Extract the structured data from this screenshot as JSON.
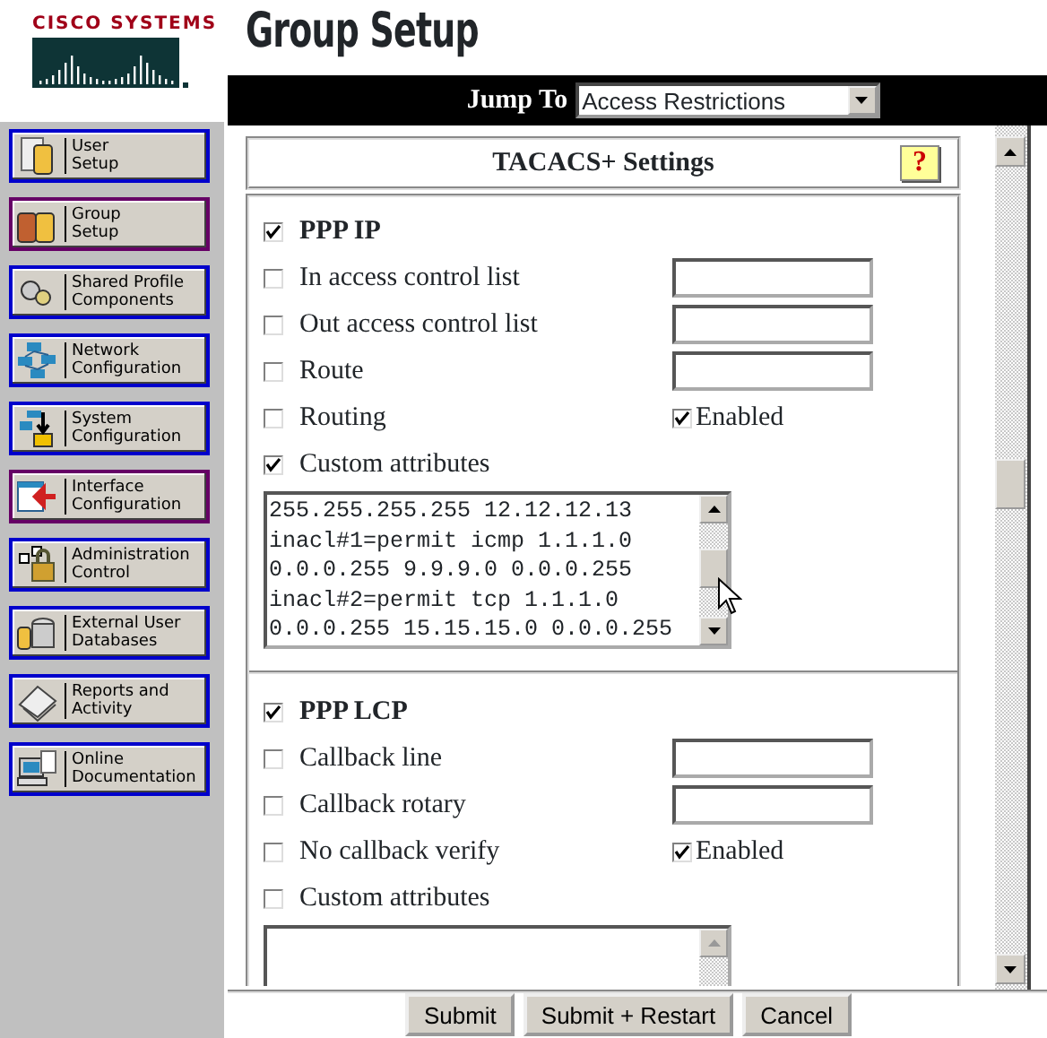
{
  "header": {
    "logo_text": "CISCO SYSTEMS",
    "title": "Group Setup"
  },
  "sidebar": {
    "items": [
      {
        "lines": [
          "User",
          "Setup"
        ],
        "color": "#0000cc"
      },
      {
        "lines": [
          "Group",
          "Setup"
        ],
        "color": "#660066"
      },
      {
        "lines": [
          "Shared Profile",
          "Components"
        ],
        "color": "#0000cc"
      },
      {
        "lines": [
          "Network",
          "Configuration"
        ],
        "color": "#0000cc"
      },
      {
        "lines": [
          "System",
          "Configuration"
        ],
        "color": "#0000cc"
      },
      {
        "lines": [
          "Interface",
          "Configuration"
        ],
        "color": "#660066"
      },
      {
        "lines": [
          "Administration",
          "Control"
        ],
        "color": "#0000cc"
      },
      {
        "lines": [
          "External User",
          "Databases"
        ],
        "color": "#0000cc"
      },
      {
        "lines": [
          "Reports and",
          "Activity"
        ],
        "color": "#0000cc"
      },
      {
        "lines": [
          "Online",
          "Documentation"
        ],
        "color": "#0000cc"
      }
    ]
  },
  "jump_to": {
    "label": "Jump To",
    "value": "Access Restrictions"
  },
  "panel": {
    "title": "TACACS+ Settings",
    "help": "?"
  },
  "sections": [
    {
      "title": "PPP IP",
      "checked": true,
      "rows": [
        {
          "kind": "text",
          "label": "In access control list",
          "checked": false
        },
        {
          "kind": "text",
          "label": "Out access control list",
          "checked": false
        },
        {
          "kind": "text",
          "label": "Route",
          "checked": false
        },
        {
          "kind": "option",
          "label": "Routing",
          "checked": false,
          "option_label": "Enabled",
          "option_checked": true
        },
        {
          "kind": "plain",
          "label": "Custom attributes",
          "checked": true
        }
      ],
      "attributes": [
        "255.255.255.255 12.12.12.13",
        "inacl#1=permit icmp 1.1.1.0",
        "0.0.0.255 9.9.9.0 0.0.0.255",
        "inacl#2=permit tcp 1.1.1.0",
        "0.0.0.255 15.15.15.0 0.0.0.255"
      ]
    },
    {
      "title": "PPP LCP",
      "checked": true,
      "rows": [
        {
          "kind": "text",
          "label": "Callback line",
          "checked": false
        },
        {
          "kind": "text",
          "label": "Callback rotary",
          "checked": false
        },
        {
          "kind": "option",
          "label": "No callback verify",
          "checked": false,
          "option_label": "Enabled",
          "option_checked": true
        },
        {
          "kind": "plain",
          "label": "Custom attributes",
          "checked": false
        }
      ]
    }
  ],
  "buttons": [
    "Submit",
    "Submit + Restart",
    "Cancel"
  ]
}
